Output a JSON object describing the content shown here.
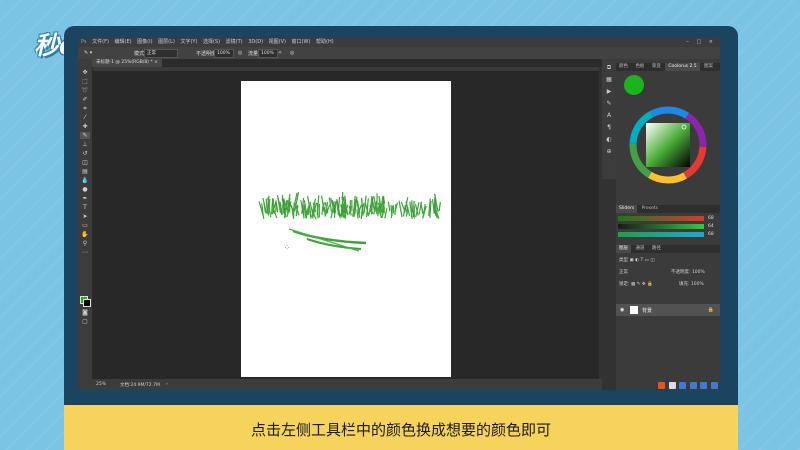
{
  "brand": {
    "logo_text": "秒dong视频"
  },
  "caption": "点击左侧工具栏中的颜色换成想要的颜色即可",
  "app": {
    "menu": [
      "文件(F)",
      "编辑(E)",
      "图像(I)",
      "图层(L)",
      "文字(Y)",
      "选择(S)",
      "滤镜(T)",
      "3D(D)",
      "视图(V)",
      "窗口(W)",
      "帮助(H)"
    ],
    "options": {
      "mode_label": "模式:",
      "mode_value": "正常",
      "opacity_label": "不透明度:",
      "opacity_value": "100%",
      "flow_label": "流量:",
      "flow_value": "100%"
    },
    "document_tab": "未标题-1 @ 25%(RGB/8) *",
    "status": {
      "zoom": "25%",
      "doc_size": "文档:24.9M/72.7M"
    },
    "colors": {
      "foreground": "#1db31d",
      "background": "#000000",
      "brush_green": "#3fa23a"
    }
  },
  "panels": {
    "top_tabs": [
      "颜色",
      "色板",
      "渐变",
      "Coolorus 2.5",
      "图案"
    ],
    "color_tabs": [
      "Sliders",
      "Presets"
    ],
    "sliders": [
      {
        "channel": "R",
        "value": "68"
      },
      {
        "channel": "G",
        "value": "64"
      },
      {
        "channel": "B",
        "value": "68"
      }
    ],
    "layers_tabs": [
      "图层",
      "通道",
      "路径"
    ],
    "kind_label": "类型",
    "blend_mode": "正常",
    "opacity": "不透明度: 100%",
    "lock_label": "锁定:",
    "fill": "填充: 100%",
    "layer_name": "背景"
  }
}
